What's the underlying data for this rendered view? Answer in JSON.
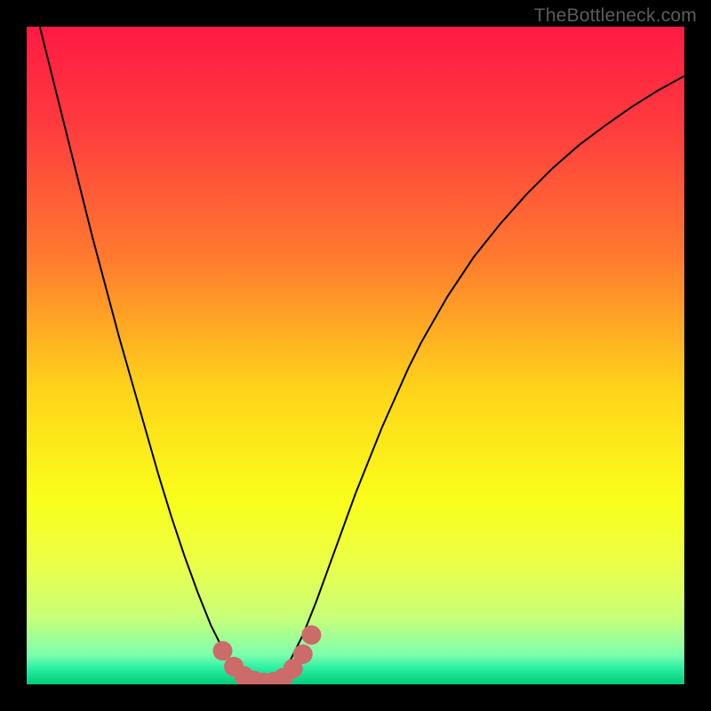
{
  "watermark": "TheBottleneck.com",
  "chart_data": {
    "type": "line",
    "title": "",
    "xlabel": "",
    "ylabel": "",
    "xlim": [
      0,
      1
    ],
    "ylim": [
      0,
      1
    ],
    "background_gradient": {
      "stops": [
        {
          "offset": 0.0,
          "color": "#ff1a44"
        },
        {
          "offset": 0.15,
          "color": "#ff3b3e"
        },
        {
          "offset": 0.35,
          "color": "#ff7a2f"
        },
        {
          "offset": 0.55,
          "color": "#ffd31a"
        },
        {
          "offset": 0.72,
          "color": "#f9ff1a"
        },
        {
          "offset": 0.82,
          "color": "#eaff4a"
        },
        {
          "offset": 0.9,
          "color": "#c7ff7a"
        },
        {
          "offset": 0.955,
          "color": "#7dffad"
        },
        {
          "offset": 0.975,
          "color": "#2bf0a2"
        },
        {
          "offset": 1.0,
          "color": "#02cc7b"
        }
      ]
    },
    "series": [
      {
        "name": "bottleneck-curve",
        "stroke": "#000000",
        "stroke_width": 2,
        "x": [
          0.0,
          0.02,
          0.04,
          0.06,
          0.08,
          0.1,
          0.12,
          0.14,
          0.16,
          0.18,
          0.2,
          0.22,
          0.24,
          0.26,
          0.28,
          0.3,
          0.31,
          0.32,
          0.33,
          0.34,
          0.35,
          0.36,
          0.37,
          0.38,
          0.39,
          0.4,
          0.42,
          0.44,
          0.46,
          0.48,
          0.5,
          0.52,
          0.54,
          0.56,
          0.58,
          0.6,
          0.64,
          0.68,
          0.72,
          0.76,
          0.8,
          0.84,
          0.88,
          0.92,
          0.96,
          1.0
        ],
        "y": [
          1.08,
          1.0,
          0.92,
          0.84,
          0.76,
          0.68,
          0.605,
          0.53,
          0.46,
          0.39,
          0.32,
          0.255,
          0.195,
          0.14,
          0.09,
          0.05,
          0.036,
          0.024,
          0.015,
          0.008,
          0.004,
          0.002,
          0.004,
          0.01,
          0.02,
          0.035,
          0.075,
          0.125,
          0.18,
          0.235,
          0.29,
          0.34,
          0.39,
          0.435,
          0.48,
          0.52,
          0.59,
          0.65,
          0.7,
          0.745,
          0.785,
          0.82,
          0.85,
          0.878,
          0.903,
          0.925
        ]
      }
    ],
    "overlay": {
      "name": "highlight-dots",
      "color": "#cd6a6a",
      "radius": 11,
      "x": [
        0.298,
        0.315,
        0.33,
        0.345,
        0.36,
        0.375,
        0.39,
        0.405,
        0.42,
        0.433
      ],
      "y": [
        0.051,
        0.027,
        0.013,
        0.006,
        0.003,
        0.004,
        0.01,
        0.024,
        0.046,
        0.075
      ]
    }
  }
}
